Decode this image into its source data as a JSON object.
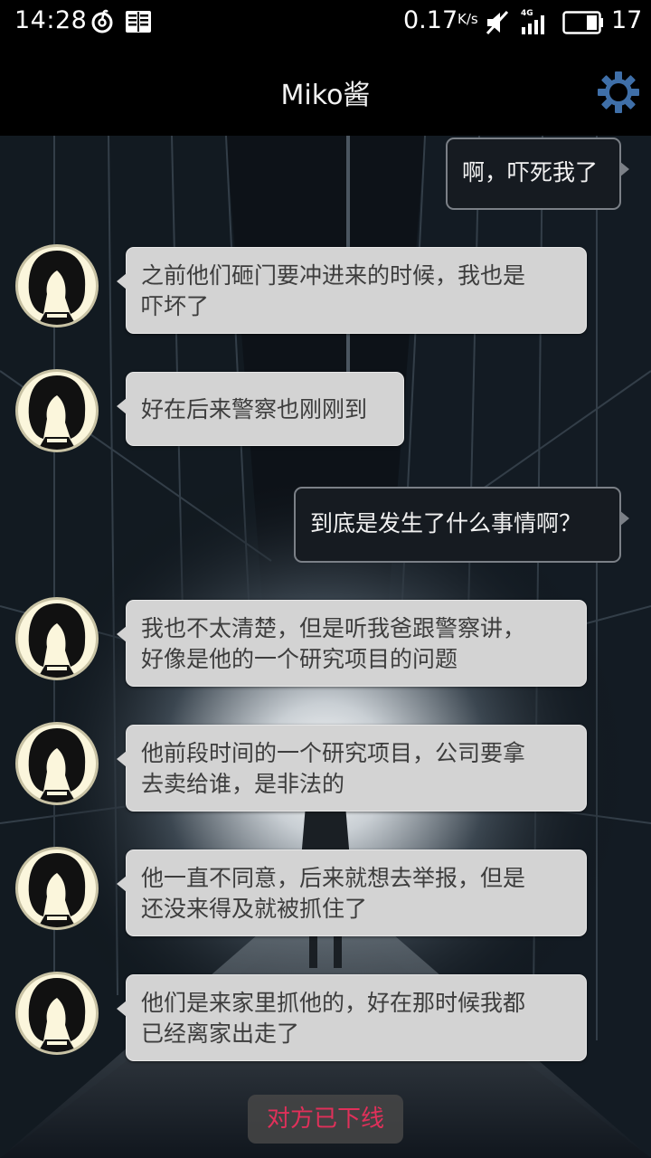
{
  "status_bar": {
    "time": "14:28",
    "net_speed": "0.17",
    "net_speed_unit": "K/s",
    "network_type": "4G",
    "battery_level": "17",
    "icons": [
      "netease-music-icon",
      "reader-icon",
      "mute-icon",
      "signal-icon",
      "battery-icon"
    ]
  },
  "header": {
    "title": "Miko酱",
    "settings_icon": "gear-icon"
  },
  "messages": [
    {
      "side": "out",
      "text": "啊，吓死我了"
    },
    {
      "side": "in",
      "lines": [
        "之前他们砸门要冲进来的时候，我也是",
        "吓坏了"
      ]
    },
    {
      "side": "in",
      "lines": [
        "好在后来警察也刚刚到"
      ]
    },
    {
      "side": "out",
      "text": "到底是发生了什么事情啊？"
    },
    {
      "side": "in",
      "lines": [
        "我也不太清楚，但是听我爸跟警察讲，",
        "好像是他的一个研究项目的问题"
      ]
    },
    {
      "side": "in",
      "lines": [
        "他前段时间的一个研究项目，公司要拿",
        "去卖给谁，是非法的"
      ]
    },
    {
      "side": "in",
      "lines": [
        "他一直不同意，后来就想去举报，但是",
        "还没来得及就被抓住了"
      ]
    },
    {
      "side": "in",
      "lines": [
        "他们是来家里抓他的，好在那时候我都",
        "已经离家出走了"
      ]
    }
  ],
  "status_notice": "对方已下线",
  "colors": {
    "accent_settings": "#3f6fa8",
    "incoming_bubble": "#d3d3d3",
    "outgoing_bubble": "#161b21",
    "offline_text": "#e0305a"
  }
}
